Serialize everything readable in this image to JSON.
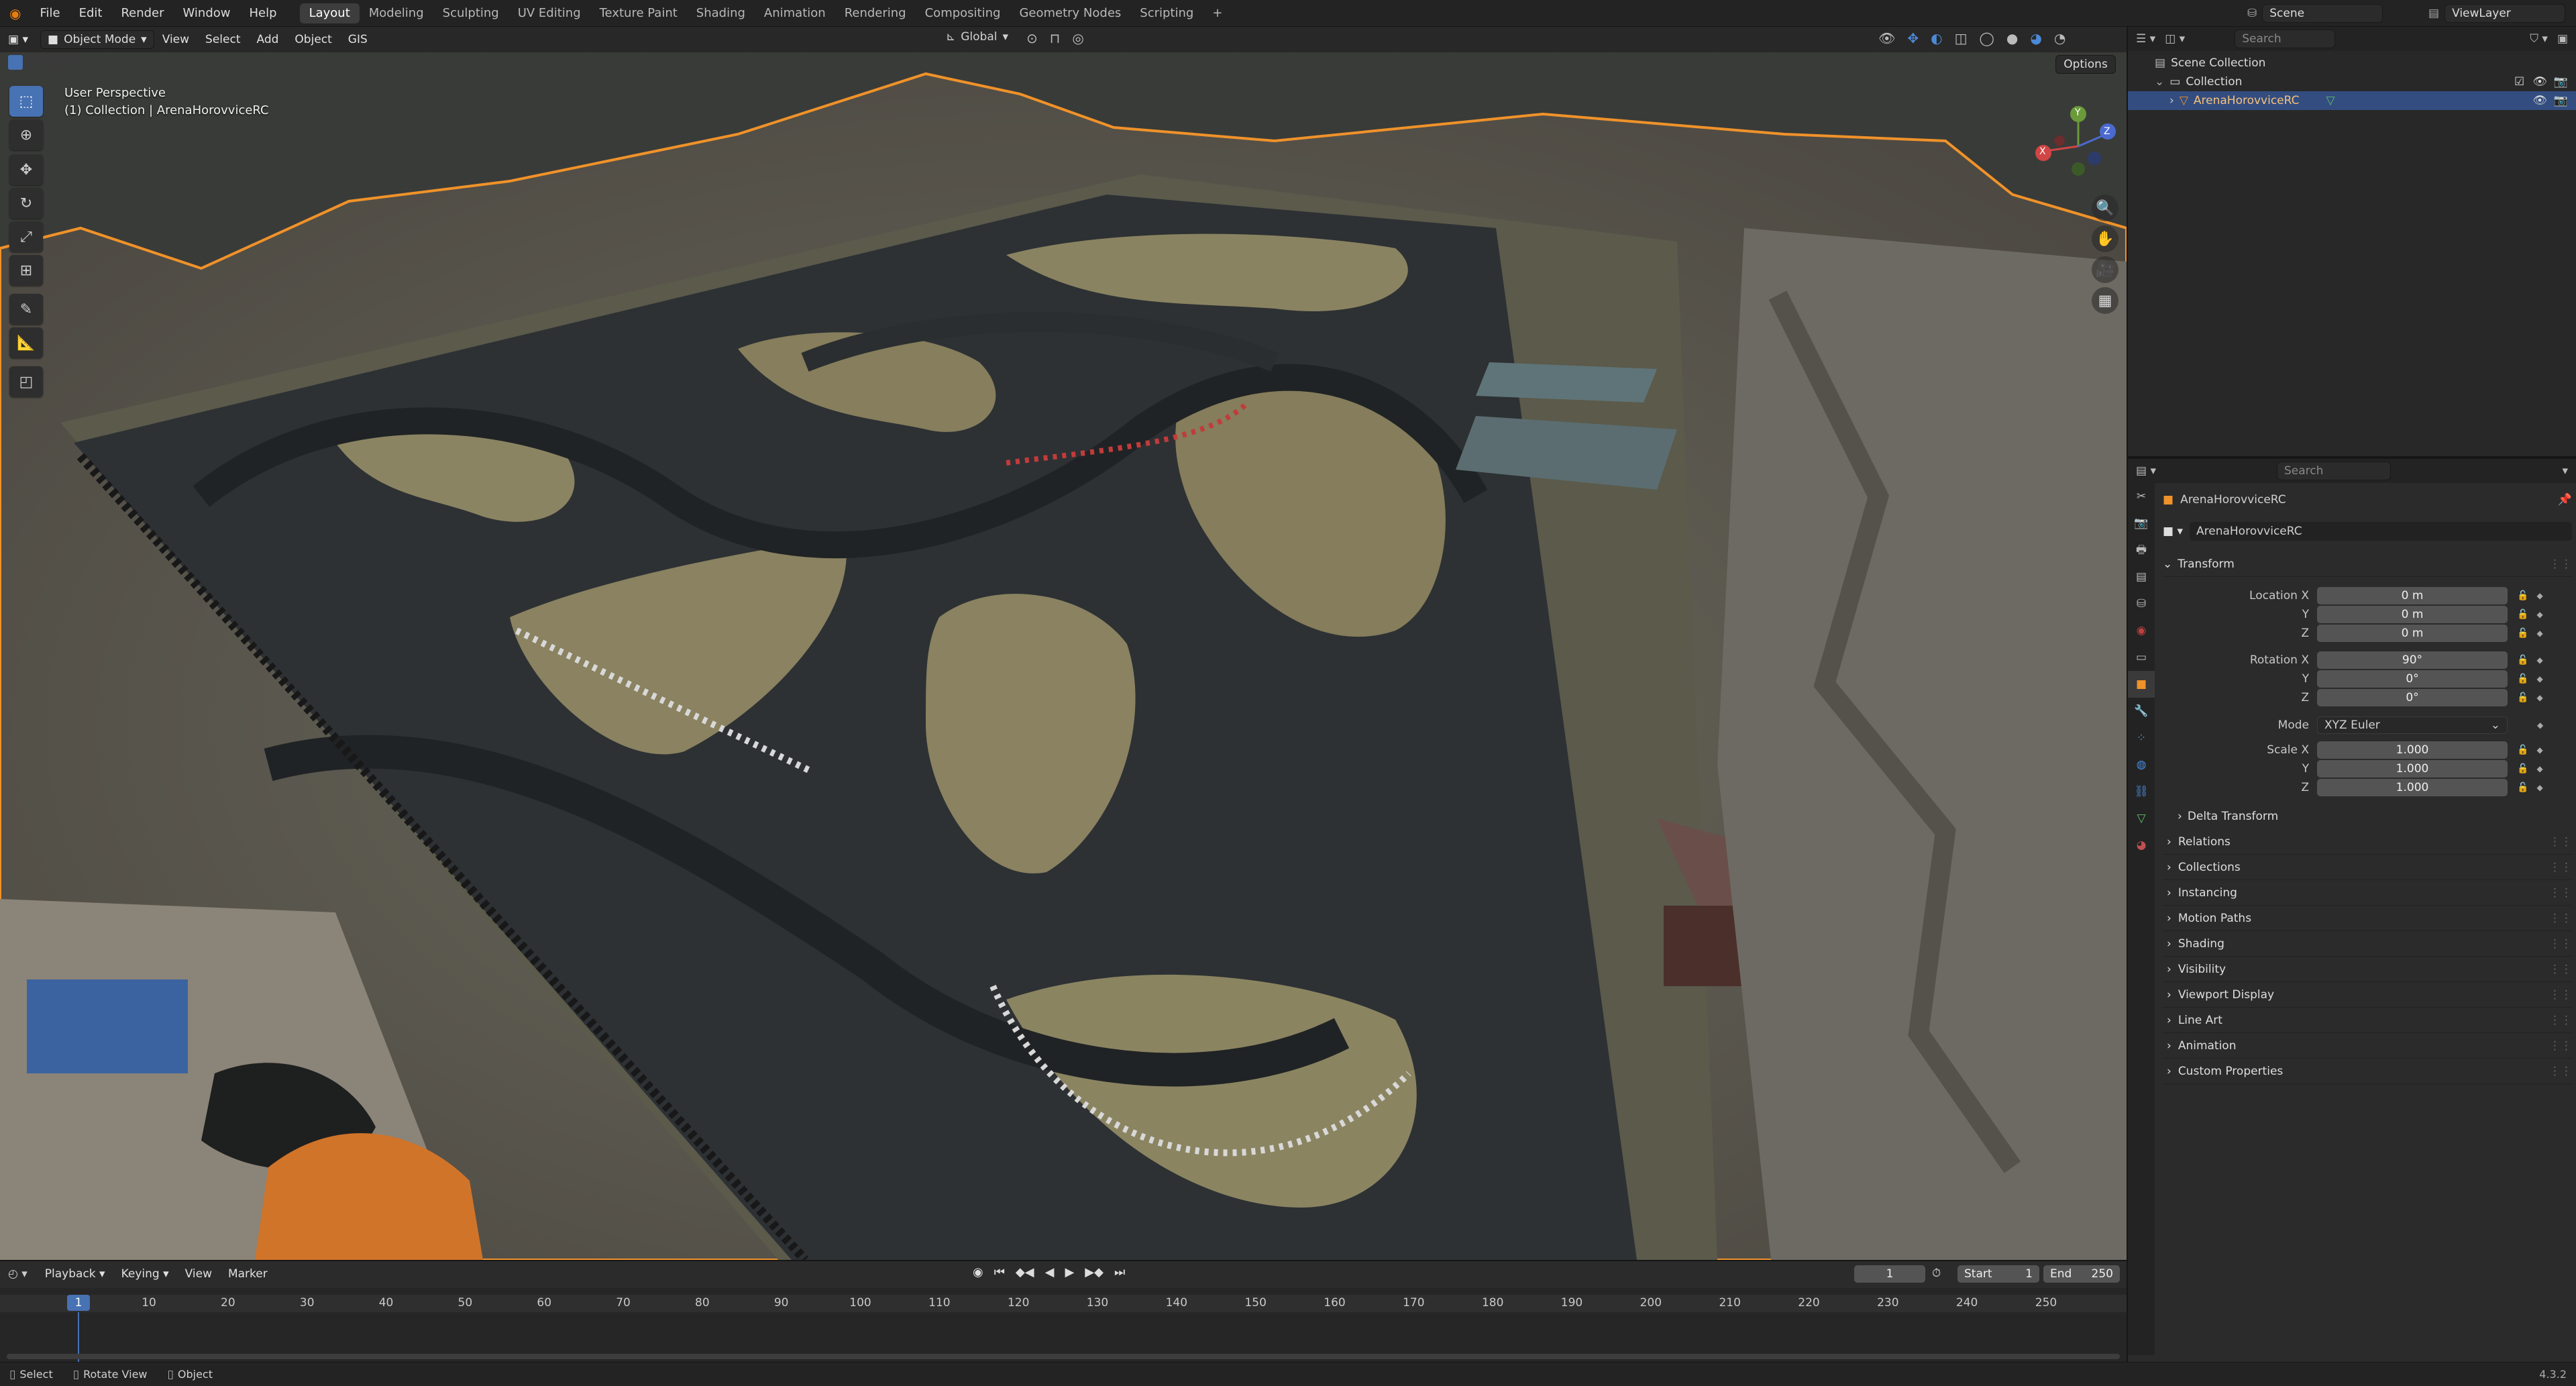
{
  "menu": {
    "items": [
      "File",
      "Edit",
      "Render",
      "Window",
      "Help"
    ]
  },
  "workspaces": [
    "Layout",
    "Modeling",
    "Sculpting",
    "UV Editing",
    "Texture Paint",
    "Shading",
    "Animation",
    "Rendering",
    "Compositing",
    "Geometry Nodes",
    "Scripting"
  ],
  "active_workspace": "Layout",
  "top_right": {
    "scene": "Scene",
    "view_layer": "ViewLayer"
  },
  "viewport_header": {
    "mode": "Object Mode",
    "menus": [
      "View",
      "Select",
      "Add",
      "Object",
      "GIS"
    ],
    "orientation": "Global",
    "options": "Options"
  },
  "viewport_overlay": {
    "perspective": "User Perspective",
    "collection_info": "(1) Collection | ArenaHorovviceRC"
  },
  "gizmo": {
    "x": "X",
    "y": "Y",
    "z": "Z"
  },
  "outliner": {
    "search_placeholder": "Search",
    "root": "Scene Collection",
    "collection": "Collection",
    "object": "ArenaHorovviceRC"
  },
  "properties": {
    "search_placeholder": "Search",
    "object_name": "ArenaHorovviceRC",
    "object_name_field": "ArenaHorovviceRC",
    "transform_label": "Transform",
    "location": {
      "label": "Location X",
      "x": "0 m",
      "y": "0 m",
      "z": "0 m"
    },
    "rotation": {
      "label": "Rotation X",
      "x": "90°",
      "y": "0°",
      "z": "0°"
    },
    "mode": {
      "label": "Mode",
      "value": "XYZ Euler"
    },
    "scale": {
      "label": "Scale X",
      "x": "1.000",
      "y": "1.000",
      "z": "1.000"
    },
    "axis_y": "Y",
    "axis_z": "Z",
    "delta": "Delta Transform",
    "sections": [
      "Relations",
      "Collections",
      "Instancing",
      "Motion Paths",
      "Shading",
      "Visibility",
      "Viewport Display",
      "Line Art",
      "Animation",
      "Custom Properties"
    ]
  },
  "timeline": {
    "menus": [
      "Playback",
      "Keying",
      "View",
      "Marker"
    ],
    "current_frame": "1",
    "start_label": "Start",
    "start": "1",
    "end_label": "End",
    "end": "250",
    "ticks": [
      "1",
      "10",
      "20",
      "30",
      "40",
      "50",
      "60",
      "70",
      "80",
      "90",
      "100",
      "110",
      "120",
      "130",
      "140",
      "150",
      "160",
      "170",
      "180",
      "190",
      "200",
      "210",
      "220",
      "230",
      "240",
      "250"
    ]
  },
  "status": {
    "select": "Select",
    "rotate": "Rotate View",
    "object": "Object",
    "version": "4.3.2"
  },
  "colors": {
    "accent": "#4772b3",
    "selection": "#f0922a",
    "header": "#232323"
  }
}
